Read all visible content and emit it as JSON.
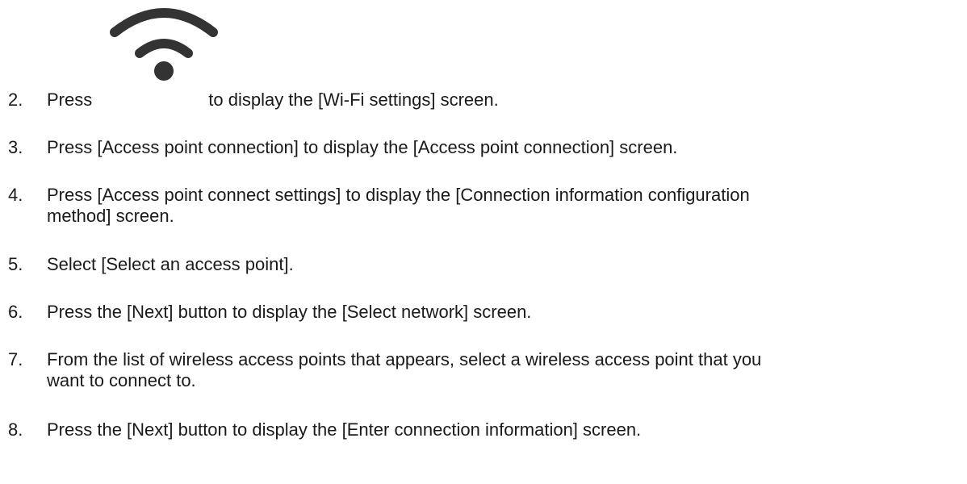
{
  "icon": "wifi-icon",
  "steps": [
    {
      "number": "2.",
      "before": "Press",
      "after": "to display the [Wi-Fi settings] screen."
    },
    {
      "number": "3.",
      "text": "Press [Access point connection] to display the [Access point connection] screen."
    },
    {
      "number": "4.",
      "line1": "Press [Access point connect settings] to display the [Connection information configuration",
      "line2": "method] screen."
    },
    {
      "number": "5.",
      "text": "Select [Select an access point]."
    },
    {
      "number": "6.",
      "text": "Press the [Next] button to display the [Select network] screen."
    },
    {
      "number": "7.",
      "line1": "From the list of wireless access points that appears, select a wireless access point that you",
      "line2": "want to connect to."
    },
    {
      "number": "8.",
      "text": "Press the [Next] button to display the [Enter connection information] screen."
    }
  ]
}
